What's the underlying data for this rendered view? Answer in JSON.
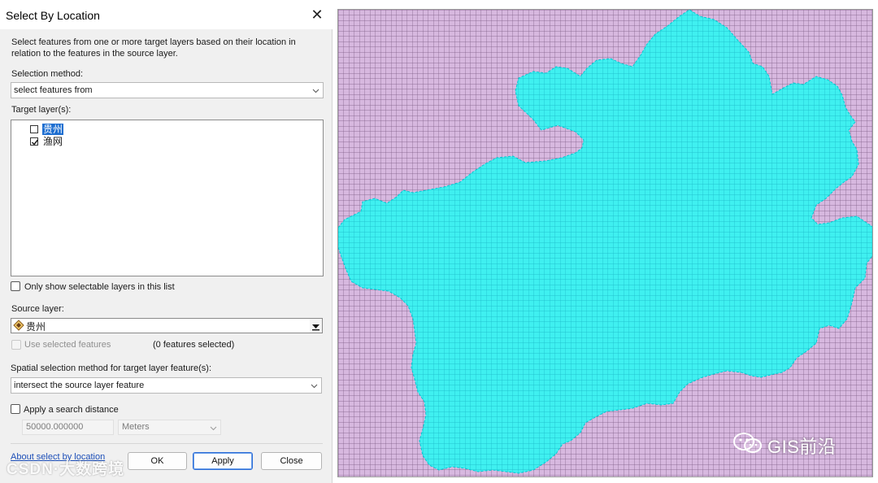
{
  "dialog": {
    "title": "Select By Location",
    "description": "Select features from one or more target layers based on their location in relation to the features in the source layer.",
    "selection_method_label": "Selection method:",
    "selection_method_value": "select features from",
    "target_layers_label": "Target layer(s):",
    "target_layers": [
      {
        "name": "贵州",
        "checked": false,
        "selected": true
      },
      {
        "name": "渔网",
        "checked": true,
        "selected": false
      }
    ],
    "only_selectable_label": "Only show selectable layers in this list",
    "source_layer_label": "Source layer:",
    "source_layer_value": "贵州",
    "use_selected_label": "Use selected features",
    "features_selected_text": "(0 features selected)",
    "spatial_method_label": "Spatial selection method for target layer feature(s):",
    "spatial_method_value": "intersect the source layer feature",
    "apply_search_distance_label": "Apply a search distance",
    "distance_value": "50000.000000",
    "distance_unit": "Meters",
    "about_link": "About select by location",
    "buttons": {
      "ok": "OK",
      "apply": "Apply",
      "close": "Close"
    }
  },
  "watermarks": {
    "left": "CSDN·大数跨境",
    "right": "GIS前沿"
  },
  "map": {
    "background_color": "#d7b8df",
    "grid_color": "#7a5a82",
    "selection_color": "#3ff0f0",
    "selection_outline_color": "#00c8d2"
  }
}
